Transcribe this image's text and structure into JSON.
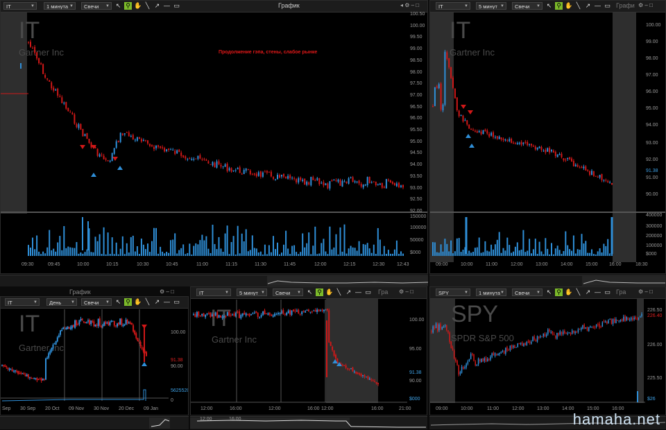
{
  "panel_main": {
    "symbol": "IT",
    "interval": "1 минута",
    "chart_type": "Свечи",
    "window_title": "График",
    "watermark_ticker": "IT",
    "watermark_name": "Gartner Inc",
    "annotation": "Продолжение гэпа, стены, слабое рынке",
    "price_axis": [
      "100.50",
      "100.00",
      "99.50",
      "99.00",
      "98.50",
      "98.00",
      "97.50",
      "97.00",
      "96.50",
      "96.00",
      "95.50",
      "95.00",
      "94.50",
      "94.00",
      "93.50",
      "93.00",
      "92.50",
      "92.00"
    ],
    "volume_axis": [
      "150000",
      "100000",
      "50000",
      "$000"
    ],
    "time_axis": [
      "09:30",
      "09:45",
      "10:00",
      "10:15",
      "10:30",
      "10:45",
      "11:00",
      "11:15",
      "11:30",
      "11:45",
      "12:00",
      "12:15",
      "12:30",
      "12:43"
    ]
  },
  "panel_right": {
    "symbol": "IT",
    "interval": "5 минут",
    "chart_type": "Свечи",
    "window_title": "Графи",
    "watermark_ticker": "IT",
    "watermark_name": "Gartner Inc",
    "price_axis": [
      "100.00",
      "99.00",
      "98.00",
      "97.00",
      "96.00",
      "95.00",
      "94.00",
      "93.00",
      "92.00",
      "91.38",
      "91.00",
      "90.00"
    ],
    "volume_axis": [
      "400000",
      "300000",
      "200000",
      "100000",
      "$000"
    ],
    "time_axis": [
      "09:00",
      "10:00",
      "11:00",
      "12:00",
      "13:00",
      "14:00",
      "15:00",
      "16:00",
      "18:30"
    ]
  },
  "panel_bl": {
    "outer_title": "График",
    "symbol": "IT",
    "interval": "День",
    "chart_type": "Свечи",
    "watermark_ticker": "IT",
    "watermark_name": "Gartner Inc",
    "price_axis": [
      "100.00",
      "91.38",
      "90.00",
      "5625520",
      "0"
    ],
    "time_axis": [
      "Sep",
      "30 Sep",
      "20 Oct",
      "09 Nov",
      "30 Nov",
      "20 Dec",
      "09 Jan"
    ]
  },
  "panel_bm": {
    "symbol": "IT",
    "interval": "5 минут",
    "chart_type": "Свечи",
    "window_title": "Гра",
    "watermark_ticker": "IT",
    "watermark_name": "Gartner Inc",
    "price_axis": [
      "100.00",
      "95.00",
      "91.38",
      "90.00",
      "$000"
    ],
    "time_axis": [
      "12:00",
      "16:00",
      "12:00",
      "16:00",
      "12:00",
      "16:00",
      "21:00"
    ],
    "nav_axis": [
      "12:00",
      "16:00"
    ]
  },
  "panel_br": {
    "symbol": "SPY",
    "interval": "1 минута",
    "chart_type": "Свечи",
    "window_title": "Гра",
    "watermark_ticker": "SPY",
    "watermark_name": "SPDR S&P 500",
    "price_axis": [
      "226.50",
      "226.40",
      "226.00",
      "225.50",
      "$26"
    ],
    "time_axis": [
      "09:00",
      "10:00",
      "11:00",
      "12:00",
      "13:00",
      "14:00",
      "15:00",
      "16:00"
    ]
  },
  "tools": [
    "cursor-icon",
    "zoom-icon",
    "hand-icon",
    "line-icon",
    "arrow-icon",
    "hline-icon",
    "rect-icon"
  ],
  "site_watermark": "hamaha.net",
  "colors": {
    "up": "#2f8fd8",
    "down": "#d01818",
    "bg": "#000000",
    "grid": "#555555"
  }
}
